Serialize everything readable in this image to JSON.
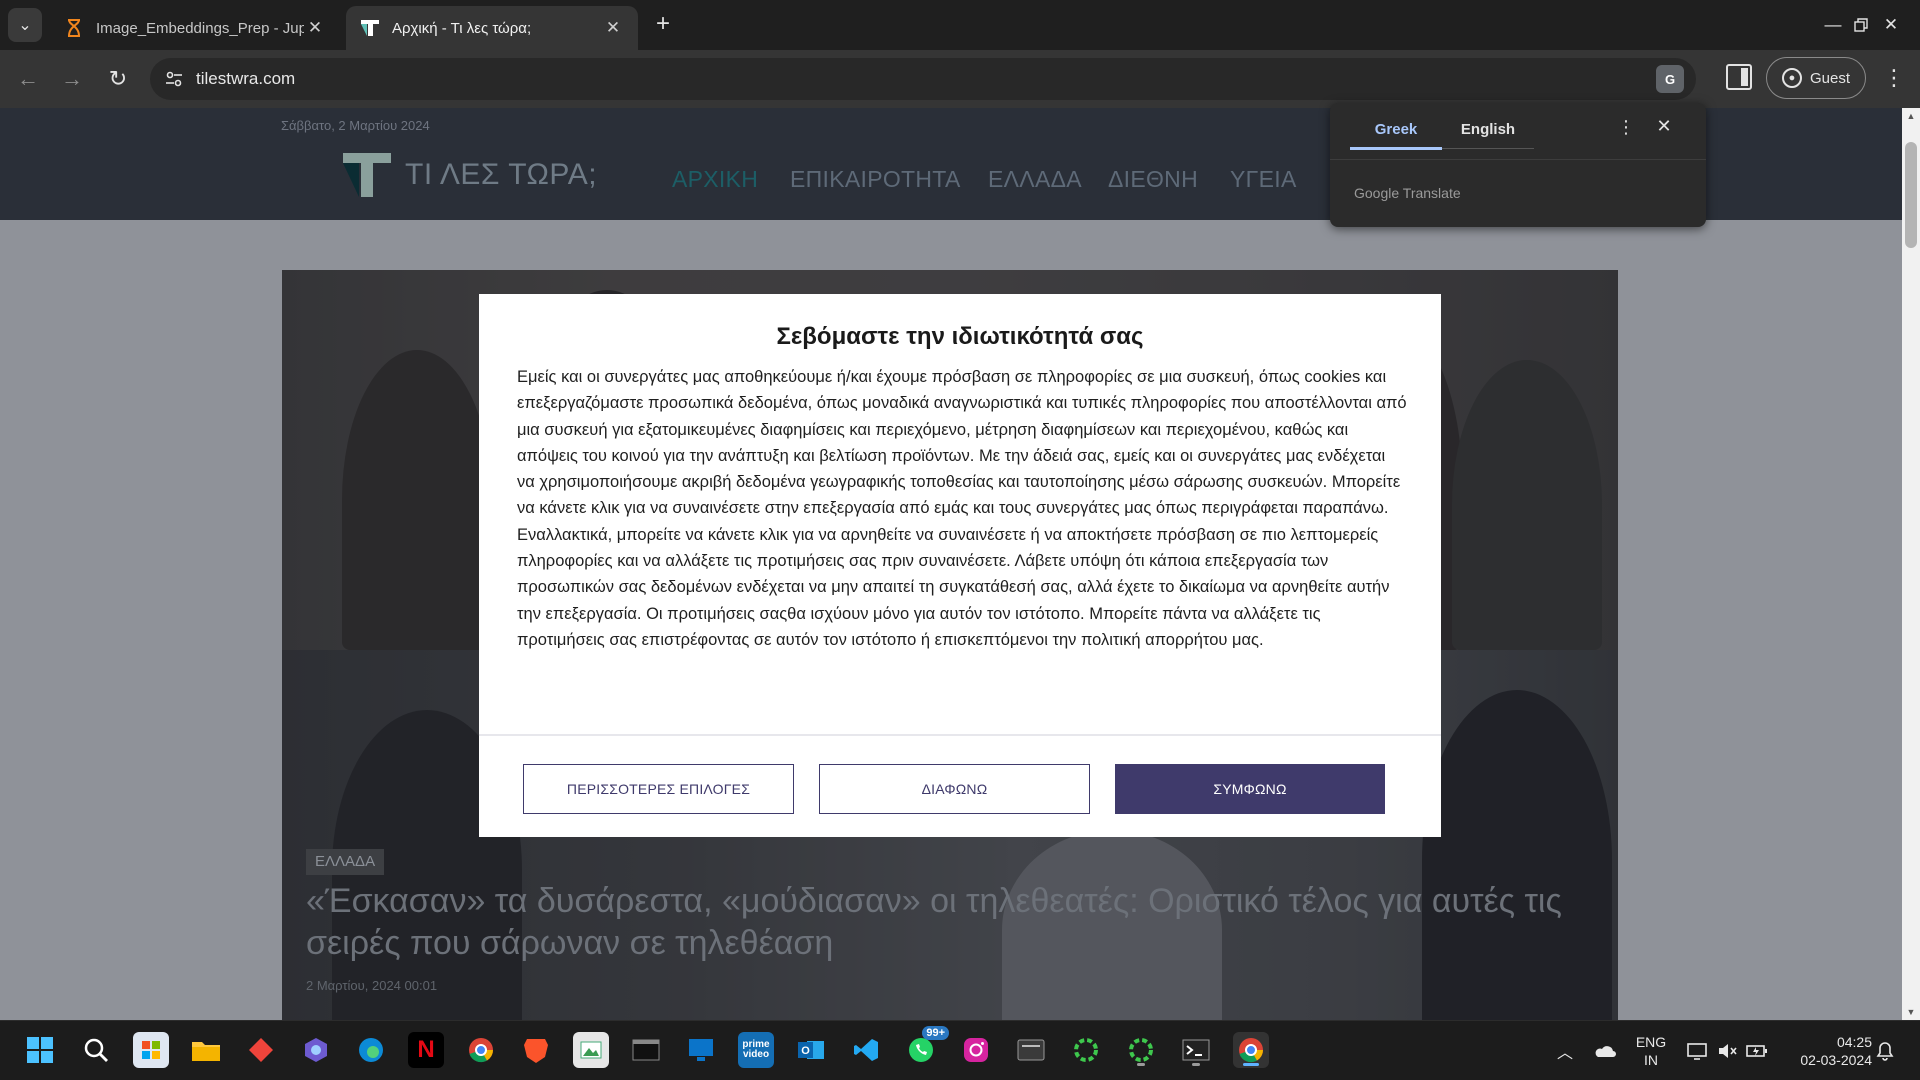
{
  "browser": {
    "tabs": [
      {
        "title": "Image_Embeddings_Prep - Jupy",
        "icon": "hourglass-icon",
        "active": false
      },
      {
        "title": "Αρχική - Τι λες τώρα;",
        "icon": "site-t-icon",
        "active": true
      }
    ],
    "new_tab": "+",
    "url": "tilestwra.com",
    "profile_label": "Guest"
  },
  "translate_popup": {
    "lang_source": "Greek",
    "lang_target": "English",
    "brand": "Google Translate"
  },
  "site": {
    "date": "Σάββατο, 2 Μαρτίου 2024",
    "logo_text": "ΤΙ ΛΕΣ ΤΩΡΑ;",
    "nav": [
      "ΑΡΧΙΚΗ",
      "ΕΠΙΚΑΙΡΟΤΗΤΑ",
      "ΕΛΛΑΔΑ",
      "ΔΙΕΘΝΗ",
      "ΥΓΕΙΑ"
    ],
    "nav_active_color": "#1c5e66"
  },
  "article": {
    "category": "ΕΛΛΑΔΑ",
    "headline": "«Έσκασαν» τα δυσάρεστα, «μούδιασαν» οι τηλεθεατές: Οριστικό τέλος για αυτές τις σειρές που σάρωναν σε τηλεθέαση",
    "date": "2 Μαρτίου, 2024 00:01"
  },
  "consent": {
    "title": "Σεβόμαστε την ιδιωτικότητά σας",
    "body": "Εμείς και οι συνεργάτες μας αποθηκεύουμε ή/και έχουμε πρόσβαση σε πληροφορίες σε μια συσκευή, όπως cookies και επεξεργαζόμαστε προσωπικά δεδομένα, όπως μοναδικά αναγνωριστικά και τυπικές πληροφορίες που αποστέλλονται από μια συσκευή για εξατομικευμένες διαφημίσεις και περιεχόμενο, μέτρηση διαφημίσεων και περιεχομένου, καθώς και απόψεις του κοινού για την ανάπτυξη και βελτίωση προϊόντων. Με την άδειά σας, εμείς και οι συνεργάτες μας ενδέχεται να χρησιμοποιήσουμε ακριβή δεδομένα γεωγραφικής τοποθεσίας και ταυτοποίησης μέσω σάρωσης συσκευών. Μπορείτε να κάνετε κλικ για να συναινέσετε στην επεξεργασία από εμάς και τους συνεργάτες μας όπως περιγράφεται παραπάνω. Εναλλακτικά, μπορείτε να κάνετε κλικ για να αρνηθείτε να συναινέσετε ή να αποκτήσετε πρόσβαση σε πιο λεπτομερείς πληροφορίες και να αλλάξετε τις προτιμήσεις σας πριν συναινέσετε. Λάβετε υπόψη ότι κάποια επεξεργασία των προσωπικών σας δεδομένων ενδέχεται να μην απαιτεί τη συγκατάθεσή σας, αλλά έχετε το δικαίωμα να αρνηθείτε αυτήν την επεξεργασία. Οι προτιμήσεις σαςθα ισχύουν μόνο για αυτόν τον ιστότοπο. Μπορείτε πάντα να αλλάξετε τις προτιμήσεις σας επιστρέφοντας σε αυτόν τον ιστότοπο ή επισκεπτόμενοι την πολιτική απορρήτου μας.",
    "more_options": "ΠΕΡΙΣΣΟΤΕΡΕΣ ΕΠΙΛΟΓΕΣ",
    "disagree": "ΔΙΑΦΩΝΩ",
    "agree": "ΣΥΜΦΩΝΩ",
    "accent_color": "#3f3a6b"
  },
  "taskbar": {
    "whatsapp_badge": "99+",
    "language": "ENG",
    "region": "IN",
    "time": "04:25",
    "date": "02-03-2024"
  }
}
